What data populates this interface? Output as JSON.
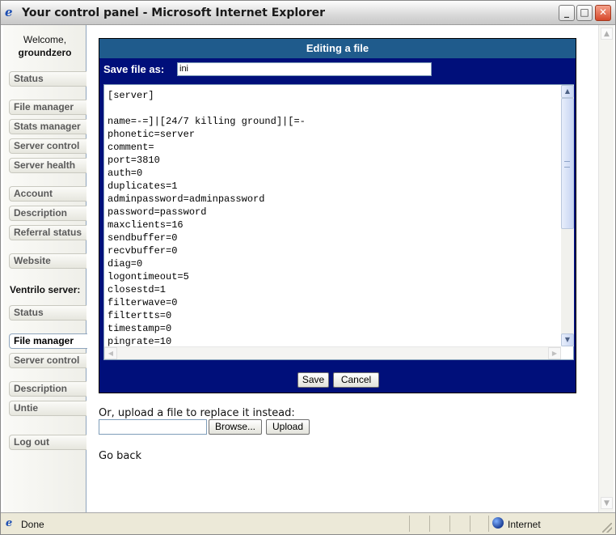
{
  "window": {
    "title": "Your control panel - Microsoft Internet Explorer",
    "minimize": "_",
    "maximize": "□",
    "close": "✕"
  },
  "nav": {
    "welcome": "Welcome,",
    "username": "groundzero",
    "items": [
      {
        "label": "Status"
      },
      {
        "label": "File manager"
      },
      {
        "label": "Stats manager"
      },
      {
        "label": "Server control"
      },
      {
        "label": "Server health"
      },
      {
        "label": "Account"
      },
      {
        "label": "Description"
      },
      {
        "label": "Referral status"
      },
      {
        "label": "Website"
      }
    ],
    "ventrilo_heading": "Ventrilo server:",
    "vitems": [
      {
        "label": "Status"
      },
      {
        "label": "File manager",
        "active": true
      },
      {
        "label": "Server control"
      },
      {
        "label": "Description"
      },
      {
        "label": "Untie"
      },
      {
        "label": "Log out"
      }
    ]
  },
  "editor": {
    "title": "Editing a file",
    "save_as_label": "Save file as:",
    "filename": "ini",
    "lines": [
      "[server]",
      "",
      "name=-=]|[24/7 killing ground]|[=-",
      "phonetic=server",
      "comment=",
      "port=3810",
      "auth=0",
      "duplicates=1",
      "adminpassword=adminpassword",
      "password=password",
      "maxclients=16",
      "sendbuffer=0",
      "recvbuffer=0",
      "diag=0",
      "logontimeout=5",
      "closestd=1",
      "filterwave=0",
      "filtertts=0",
      "timestamp=0",
      "pingrate=10"
    ],
    "save_button": "Save",
    "cancel_button": "Cancel"
  },
  "upload": {
    "label": "Or, upload a file to replace it instead:",
    "browse_button": "Browse...",
    "upload_button": "Upload"
  },
  "go_back": "Go back",
  "statusbar": {
    "status": "Done",
    "zone": "Internet"
  }
}
